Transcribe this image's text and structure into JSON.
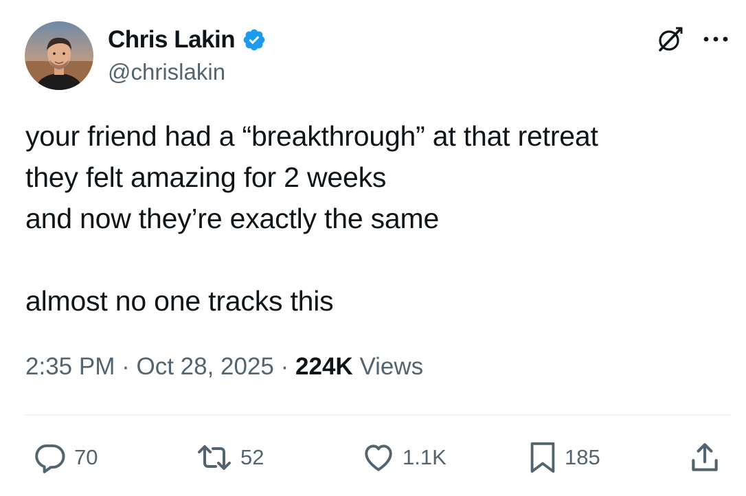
{
  "author": {
    "display_name": "Chris Lakin",
    "handle": "@chrislakin",
    "verified": true,
    "verified_color": "#1d9bf0"
  },
  "tweet": {
    "lines": [
      "your friend had a “breakthrough” at that retreat",
      "they felt amazing for 2 weeks",
      "and now they’re exactly the same",
      "",
      "almost no one tracks this"
    ]
  },
  "meta": {
    "time": "2:35 PM",
    "separator": "·",
    "date": "Oct 28, 2025",
    "views_count": "224K",
    "views_label": "Views"
  },
  "actions": {
    "reply": {
      "icon": "reply-icon",
      "count": "70"
    },
    "retweet": {
      "icon": "retweet-icon",
      "count": "52"
    },
    "like": {
      "icon": "heart-icon",
      "count": "1.1K"
    },
    "bookmark": {
      "icon": "bookmark-icon",
      "count": "185"
    },
    "share": {
      "icon": "share-icon"
    }
  },
  "header_icons": [
    "grok-icon",
    "more-icon"
  ],
  "colors": {
    "text_primary": "#0f1419",
    "text_secondary": "#536471",
    "divider": "#eff3f4"
  }
}
